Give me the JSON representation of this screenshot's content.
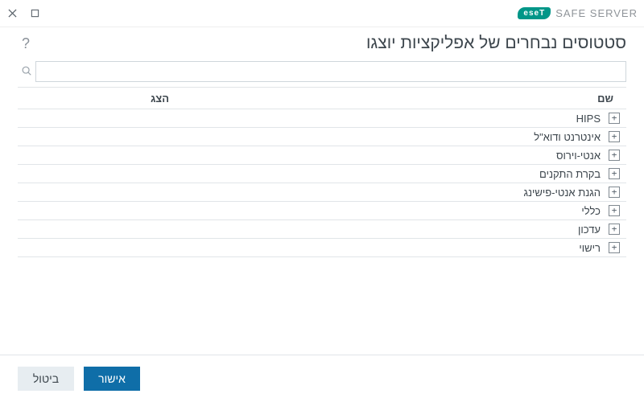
{
  "brand": {
    "badge": "eseT",
    "product": "SAFE SERVER"
  },
  "dialog": {
    "title": "סטטוסים נבחרים של אפליקציות יוצגו"
  },
  "search": {
    "placeholder": ""
  },
  "columns": {
    "show": "הצג",
    "name": "שם"
  },
  "rows": [
    {
      "label": "HIPS",
      "selected": false
    },
    {
      "label": "אינטרנט ודוא\"ל",
      "selected": false
    },
    {
      "label": "אנטי-וירוס",
      "selected": false
    },
    {
      "label": "בקרת התקנים",
      "selected": false
    },
    {
      "label": "הגנת אנטי-פישינג",
      "selected": false
    },
    {
      "label": "כללי",
      "selected": true
    },
    {
      "label": "עדכון",
      "selected": false
    },
    {
      "label": "רישוי",
      "selected": false
    }
  ],
  "buttons": {
    "ok": "אישור",
    "cancel": "ביטול"
  }
}
